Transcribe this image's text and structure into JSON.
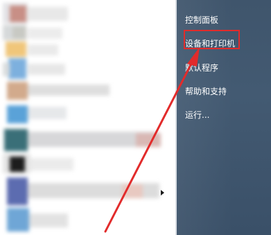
{
  "start_menu": {
    "right_items": [
      {
        "label": "控制面板"
      },
      {
        "label": "设备和打印机"
      },
      {
        "label": "默认程序"
      },
      {
        "label": "帮助和支持"
      },
      {
        "label": "运行..."
      }
    ],
    "highlighted_item": "设备和打印机"
  },
  "annotation": {
    "color": "#e22b2b",
    "pointer": "arrow"
  },
  "colors": {
    "right_panel": "#435a72",
    "left_panel": "#ffffff",
    "menu_text": "#ffffff"
  },
  "icons": {
    "submenu_arrow": "chevron-right-icon"
  }
}
